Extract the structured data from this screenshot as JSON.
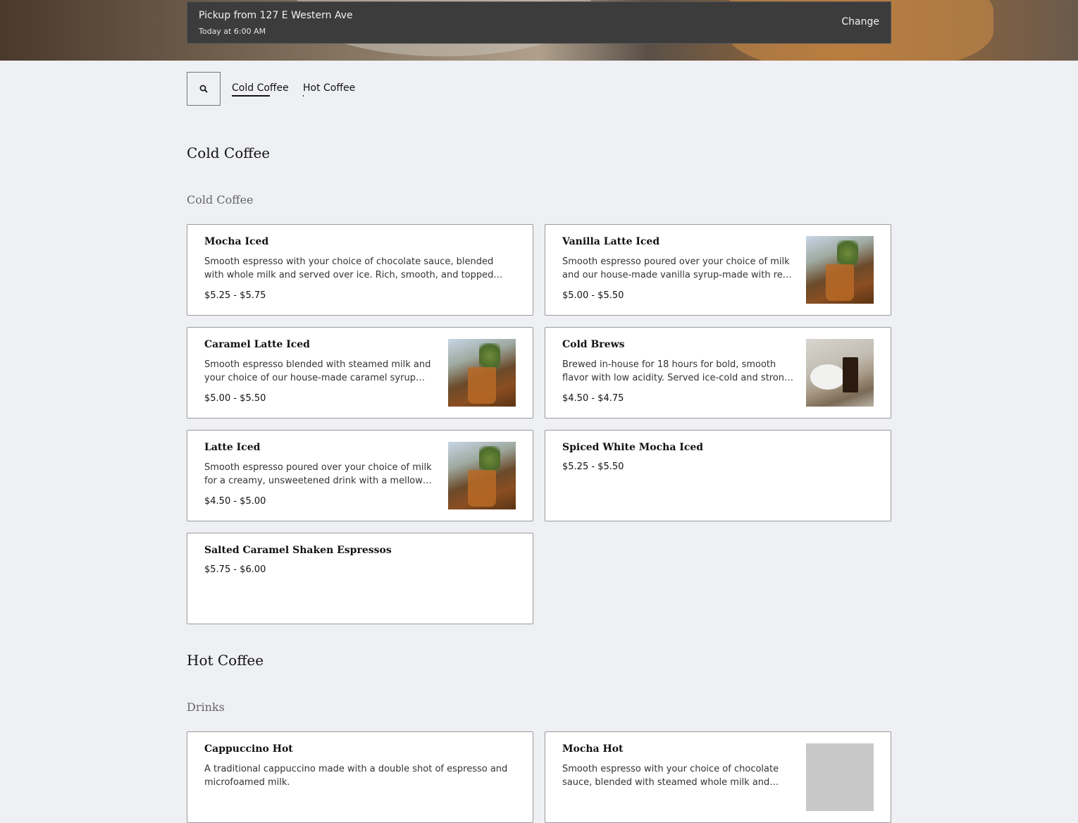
{
  "pickup": {
    "title": "Pickup from 127 E Western Ave",
    "time": "Today at 6:00 AM",
    "change_label": "Change"
  },
  "nav": {
    "tabs": [
      {
        "label": "Cold Coffee",
        "active": true
      },
      {
        "label": "Hot Coffee",
        "active": false
      }
    ]
  },
  "sections": [
    {
      "title": "Cold Coffee",
      "subtitle": "Cold Coffee",
      "items": [
        {
          "name": "Mocha Iced",
          "description": "Smooth espresso with your choice of chocolate sauce, blended with whole milk and served over ice. Rich, smooth, and topped with a light…",
          "price": "$5.25 - $5.75",
          "image": "none"
        },
        {
          "name": "Vanilla Latte Iced",
          "description": "Smooth espresso poured over your choice of milk and our house-made vanilla syrup-made with real twofol…",
          "price": "$5.00 - $5.50",
          "image": "iced-latte-photo"
        },
        {
          "name": "Caramel Latte Iced",
          "description": "Smooth espresso blended with steamed milk and your choice of our house-made caramel syrup made from…",
          "price": "$5.00 - $5.50",
          "image": "iced-latte-photo"
        },
        {
          "name": "Cold Brews",
          "description": "Brewed in-house for 18 hours for bold, smooth flavor with low acidity. Served ice-cold and strong. Not…",
          "price": "$4.50 - $4.75",
          "image": "cold-brew-photo"
        },
        {
          "name": "Latte Iced",
          "description": "Smooth espresso poured over your choice of milk for a creamy, unsweetened drink with a mellow coffee flavor.",
          "price": "$4.50 - $5.00",
          "image": "iced-latte-photo"
        },
        {
          "name": "Spiced White Mocha Iced",
          "description": "",
          "price": "$5.25 - $5.50",
          "image": "none"
        },
        {
          "name": "Salted Caramel Shaken Espressos",
          "description": "",
          "price": "$5.75 - $6.00",
          "image": "none"
        }
      ]
    },
    {
      "title": "Hot Coffee",
      "subtitle": "Drinks",
      "items": [
        {
          "name": "Cappuccino Hot",
          "description": "A traditional cappuccino made with a double shot of espresso and microfoamed milk.",
          "price": "",
          "image": "none"
        },
        {
          "name": "Mocha Hot",
          "description": "Smooth espresso with your choice of chocolate sauce, blended with steamed whole milk and finished with…",
          "price": "",
          "image": "image-placeholder"
        }
      ]
    }
  ],
  "colors": {
    "page_background": "#eff0f4",
    "pickup_bar": "#3c3c3c",
    "card_border": "#9a9a9a"
  },
  "icons": {
    "search": "search-icon"
  }
}
